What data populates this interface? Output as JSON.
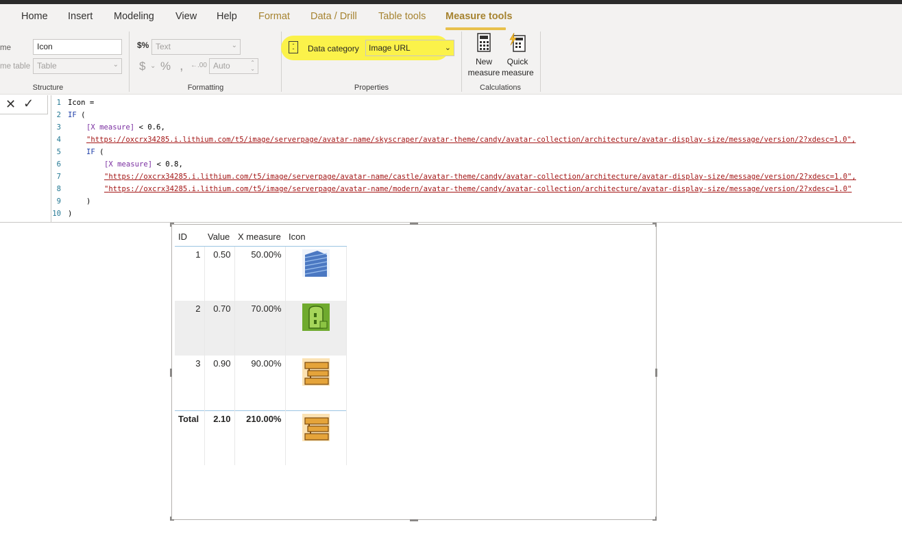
{
  "tabs": [
    {
      "label": "Home"
    },
    {
      "label": "Insert"
    },
    {
      "label": "Modeling"
    },
    {
      "label": "View"
    },
    {
      "label": "Help"
    },
    {
      "label": "Format"
    },
    {
      "label": "Data / Drill"
    },
    {
      "label": "Table tools"
    },
    {
      "label": "Measure tools"
    }
  ],
  "structure": {
    "name_label": "me",
    "name_value": "Icon",
    "home_table_label": "me table",
    "home_table_value": "Table",
    "title": "Structure"
  },
  "formatting": {
    "format_value": "Text",
    "auto_value": "Auto",
    "title": "Formatting"
  },
  "properties": {
    "data_category_label": "Data category",
    "data_category_value": "Image URL",
    "title": "Properties"
  },
  "calculations": {
    "new_measure_l1": "New",
    "new_measure_l2": "measure",
    "quick_measure_l1": "Quick",
    "quick_measure_l2": "measure",
    "title": "Calculations"
  },
  "formula": {
    "line_numbers": [
      "1",
      "2",
      "3",
      "4",
      "5",
      "6",
      "7",
      "8",
      "9",
      "10"
    ],
    "l1": "Icon =",
    "l2_kw": "IF",
    "l2_rest": " (",
    "l3_field": "[X measure]",
    "l3_rest": " < 0.6,",
    "l4_q": "\"",
    "l4_url": "https://oxcrx34285.i.lithium.com/t5/image/serverpage/avatar-name/skyscraper/avatar-theme/candy/avatar-collection/architecture/avatar-display-size/message/version/2?xdesc=1.0",
    "l4_end": "\",",
    "l5_kw": "IF",
    "l5_rest": " (",
    "l6_field": "[X measure]",
    "l6_rest": " < 0.8,",
    "l7_q": "\"",
    "l7_url": "https://oxcrx34285.i.lithium.com/t5/image/serverpage/avatar-name/castle/avatar-theme/candy/avatar-collection/architecture/avatar-display-size/message/version/2?xdesc=1.0",
    "l7_end": "\",",
    "l8_q": "\"",
    "l8_url": "https://oxcrx34285.i.lithium.com/t5/image/serverpage/avatar-name/modern/avatar-theme/candy/avatar-collection/architecture/avatar-display-size/message/version/2?xdesc=1.0",
    "l8_end": "\"",
    "l9": ")",
    "l10": ")"
  },
  "table": {
    "headers": [
      "ID",
      "Value",
      "X measure",
      "Icon"
    ],
    "rows": [
      {
        "id": "1",
        "value": "0.50",
        "x": "50.00%",
        "icon": "skyscraper-icon"
      },
      {
        "id": "2",
        "value": "0.70",
        "x": "70.00%",
        "icon": "castle-icon"
      },
      {
        "id": "3",
        "value": "0.90",
        "x": "90.00%",
        "icon": "modern-building-icon"
      }
    ],
    "total": {
      "label": "Total",
      "value": "2.10",
      "x": "210.00%",
      "icon": "modern-building-icon"
    }
  },
  "colors": {
    "accent": "#a68330",
    "highlight": "#fbf24a",
    "header_rule": "#9bc4e2"
  }
}
